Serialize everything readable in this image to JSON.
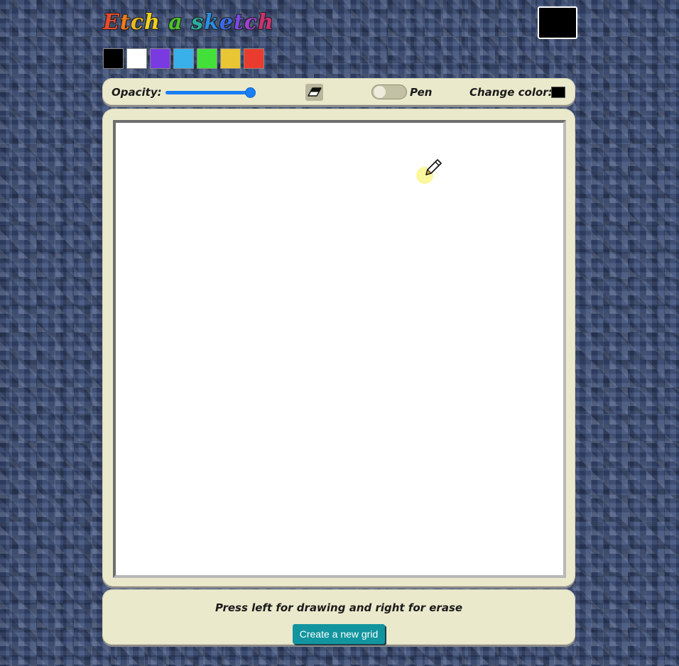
{
  "app": {
    "title_letters": [
      {
        "ch": "E",
        "color": "#e84a2a"
      },
      {
        "ch": "t",
        "color": "#f07a1a"
      },
      {
        "ch": "c",
        "color": "#e9b820"
      },
      {
        "ch": "h",
        "color": "#f0d020"
      },
      {
        "ch": " ",
        "color": "#ffffff"
      },
      {
        "ch": "a",
        "color": "#4cc42a"
      },
      {
        "ch": " ",
        "color": "#ffffff"
      },
      {
        "ch": "s",
        "color": "#2ab0a0"
      },
      {
        "ch": "k",
        "color": "#2a8ee0"
      },
      {
        "ch": "e",
        "color": "#3a6ae8"
      },
      {
        "ch": "t",
        "color": "#7a4ae0"
      },
      {
        "ch": "c",
        "color": "#a040d0"
      },
      {
        "ch": "h",
        "color": "#d03070"
      }
    ],
    "title": "Etch a sketch",
    "current_color": "#000000"
  },
  "palette": [
    "#000000",
    "#ffffff",
    "#7a3ae2",
    "#3ab0ea",
    "#44e03a",
    "#e9c634",
    "#ea3c2e"
  ],
  "toolbar": {
    "opacity_label": "Opacity:",
    "opacity_value": 1.0,
    "eraser_icon": "eraser-icon",
    "pen_label": "Pen",
    "pen_toggle_on": false,
    "change_color_label": "Change color:",
    "change_color_value": "#000000"
  },
  "footer": {
    "instructions": "Press left for drawing and right for erase",
    "new_grid_label": "Create a new grid"
  },
  "colors": {
    "panel": "#ebe9cc",
    "slider": "#1a7ef5",
    "button": "#12959e"
  }
}
